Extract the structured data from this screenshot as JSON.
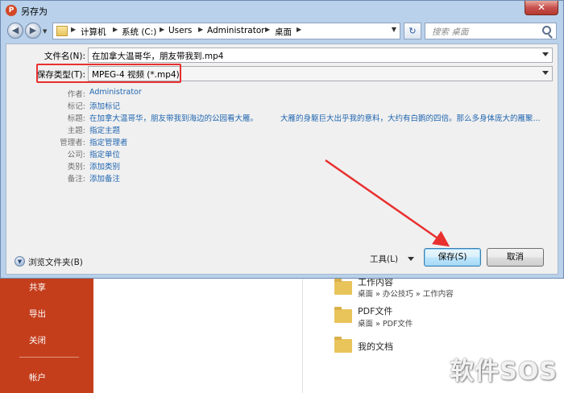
{
  "dialog": {
    "title": "另存为",
    "app_icon": "P",
    "close": "✕"
  },
  "nav": {
    "back": "◀",
    "forward": "▶",
    "breadcrumbs": [
      "计算机",
      "系统 (C:)",
      "Users",
      "Administrator",
      "桌面"
    ],
    "search_placeholder": "搜索 桌面",
    "refresh": "↻"
  },
  "form": {
    "filename_label": "文件名(N):",
    "filename_value": "在加拿大温哥华，朋友带我到.mp4",
    "filetype_label": "保存类型(T):",
    "filetype_value": "MPEG-4 视频 (*.mp4)"
  },
  "metadata": [
    {
      "label": "作者:",
      "value": "Administrator"
    },
    {
      "label": "标记:",
      "value": "添加标记"
    },
    {
      "label": "标题:",
      "value": "在加拿大温哥华，朋友带我到海边的公园看大雁。",
      "value2": "大雁的身躯巨大出乎我的意料，大约有白鹅的四倍。那么多身体庞大的雁聚..."
    },
    {
      "label": "主题:",
      "value": "指定主题"
    },
    {
      "label": "管理者:",
      "value": "指定管理者"
    },
    {
      "label": "公司:",
      "value": "指定单位"
    },
    {
      "label": "类别:",
      "value": "添加类别"
    },
    {
      "label": "备注:",
      "value": "添加备注"
    }
  ],
  "footer": {
    "browse": "浏览文件夹(B)",
    "tools": "工具(L)",
    "save": "保存(S)",
    "cancel": "取消"
  },
  "background": {
    "nav": [
      "共享",
      "导出",
      "关闭",
      "帐户"
    ],
    "folders": [
      {
        "title": "工作内容",
        "path": "桌面 » 办公技巧 » 工作内容"
      },
      {
        "title": "PDF文件",
        "path": "桌面 » PDF文件"
      },
      {
        "title": "我的文档",
        "path": ""
      }
    ],
    "watermark": "软件SOS"
  },
  "colors": {
    "accent": "#c43e1c",
    "highlight": "#e8302f",
    "link": "#2166b0"
  }
}
